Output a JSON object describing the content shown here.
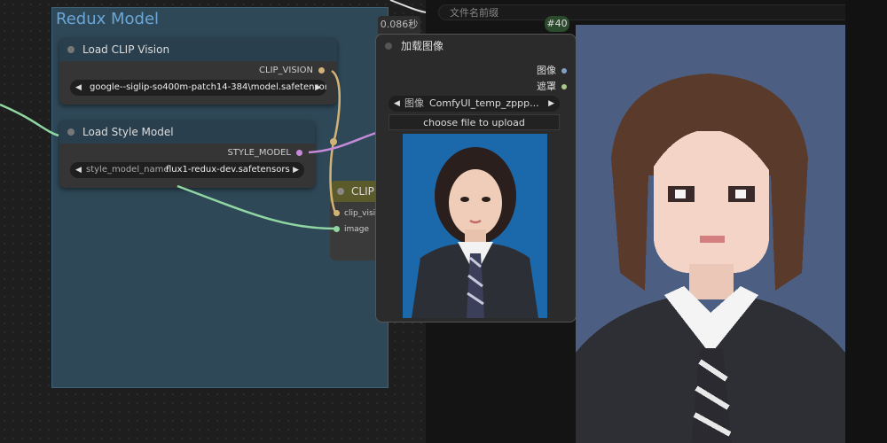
{
  "group": {
    "title": "Redux Model"
  },
  "clip_vision_node": {
    "title": "Load CLIP Vision",
    "output": "CLIP_VISION",
    "widget_value": "google--siglip-so400m-patch14-384\\model.safetensors"
  },
  "style_model_node": {
    "title": "Load Style Model",
    "output": "STYLE_MODEL",
    "widget_label": "style_model_name",
    "widget_value": "flux1-redux-dev.safetensors"
  },
  "clip_node": {
    "title": "CLIP",
    "inputs": [
      "clip_visi",
      "image"
    ]
  },
  "load_image_node": {
    "title": "加载图像",
    "timing": "0.086秒",
    "badge": "#40",
    "outputs": [
      "图像",
      "遮罩"
    ],
    "image_label": "图像",
    "image_value": "ComfyUI_temp_zppp...",
    "upload_label": "choose file to upload"
  },
  "filename_prefix": {
    "placeholder": "文件名前缀"
  },
  "colors": {
    "clip_vision_wire": "#d2b276",
    "style_model_wire": "#c58bd9",
    "image_wire": "#8fd6a2",
    "group_bg": "#2f4858"
  },
  "icons": [
    "arrow-left-icon",
    "arrow-right-icon",
    "node-status-dot-icon"
  ]
}
